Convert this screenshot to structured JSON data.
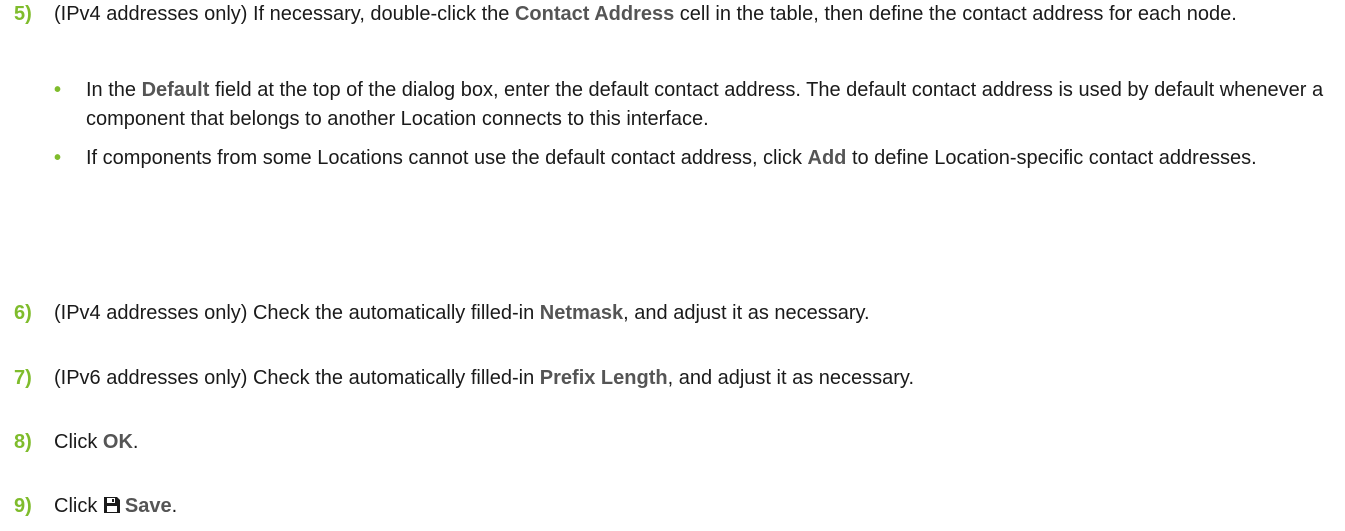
{
  "accent_color": "#7fbc2c",
  "steps": [
    {
      "num": "5)",
      "pre": "(IPv4 addresses only) If necessary, double-click the ",
      "bold": "Contact Address",
      "post": " cell in the table, then define the contact address for each node."
    },
    {
      "num": "6)",
      "pre": "(IPv4 addresses only) Check the automatically filled-in ",
      "bold": "Netmask",
      "post": ", and adjust it as necessary."
    },
    {
      "num": "7)",
      "pre": "(IPv6 addresses only) Check the automatically filled-in ",
      "bold": "Prefix Length",
      "post": ", and adjust it as necessary."
    },
    {
      "num": "8)",
      "pre": "Click ",
      "bold": "OK",
      "post": "."
    },
    {
      "num": "9)",
      "pre": "Click ",
      "icon": "save-icon",
      "bold": "Save",
      "post": "."
    }
  ],
  "bullets": [
    {
      "marker": "•",
      "pre": "In the ",
      "bold": "Default",
      "post": " field at the top of the dialog box, enter the default contact address. The default contact address is used by default whenever a component that belongs to another Location connects to this interface."
    },
    {
      "marker": "•",
      "pre": "If components from some Locations cannot use the default contact address, click ",
      "bold": "Add",
      "post": " to define Location-specific contact addresses."
    }
  ]
}
